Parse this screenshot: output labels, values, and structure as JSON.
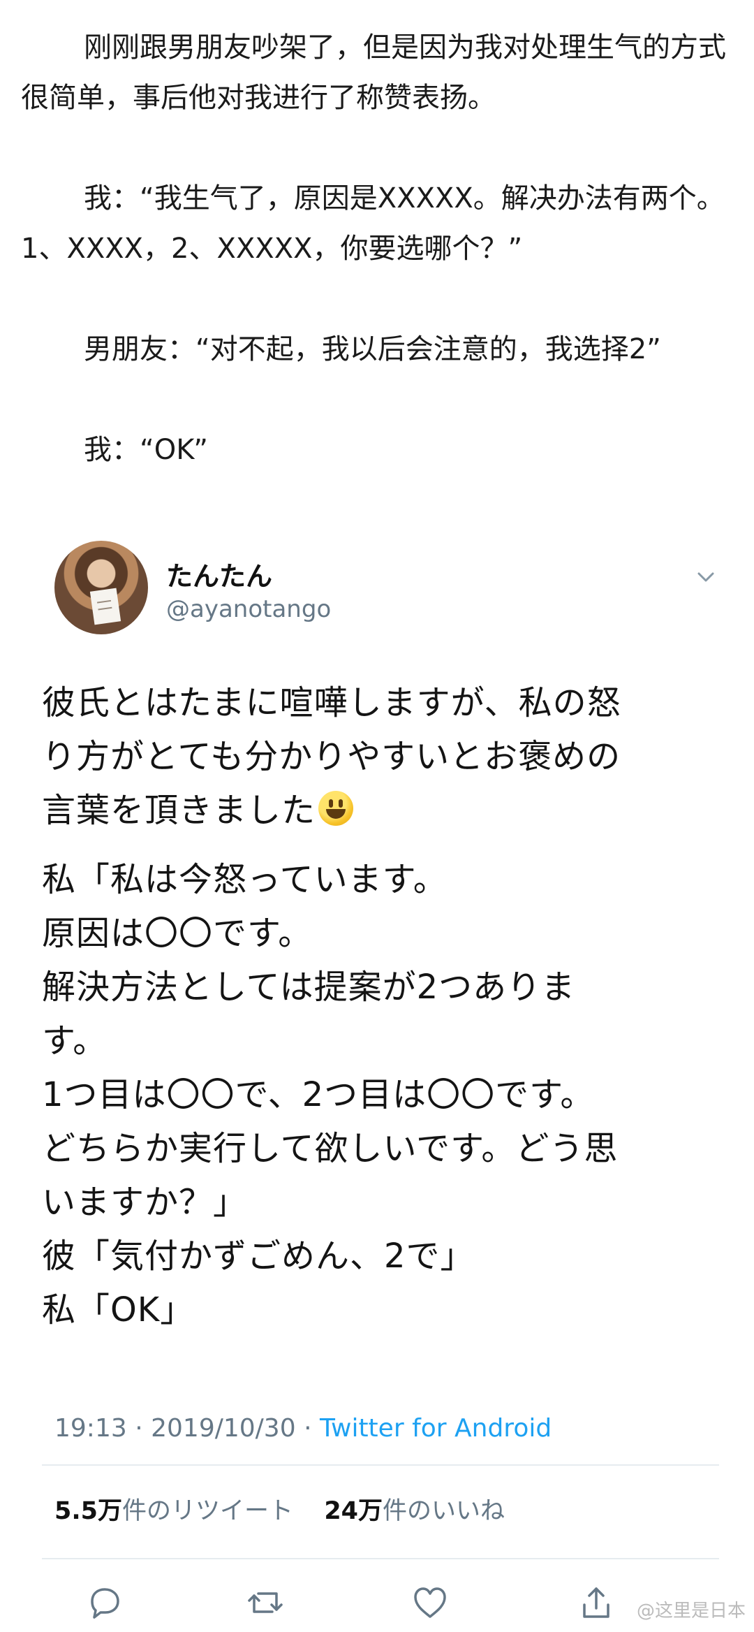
{
  "intro": {
    "paragraphs": [
      "刚刚跟男朋友吵架了，但是因为我对处理生气的方式很简单，事后他对我进行了称赞表扬。",
      "我：“我生气了，原因是XXXXX。解决办法有两个。1、XXXX，2、XXXXX，你要选哪个？”",
      "男朋友：“对不起，我以后会注意的，我选择2”",
      "我：“OK”"
    ]
  },
  "tweet": {
    "name": "たんたん",
    "handle": "@ayanotango",
    "icons": {
      "menu": "chevron-down-icon",
      "avatar": "avatar",
      "emoji": "grinning-face-emoji",
      "reply": "reply-icon",
      "retweet": "retweet-icon",
      "like": "heart-icon",
      "share": "share-icon"
    },
    "body": [
      "彼氏とはたまに喧嘩しますが、私の怒",
      "り方がとても分かりやすいとお褒めの",
      "言葉を頂きました",
      "",
      "私「私は今怒っています。",
      "原因は〇〇です。",
      "解決方法としては提案が2つありま",
      "す。",
      "1つ目は〇〇で、2つ目は〇〇です。",
      "どちらか実行して欲しいです。どう思",
      "いますか？」",
      "彼「気付かずごめん、2で」",
      "私「OK」"
    ],
    "time": "19:13",
    "date": "2019/10/30",
    "separator": "·",
    "source": "Twitter for Android",
    "retweet_count": "5.5万",
    "retweet_label": "件のリツイート",
    "like_count": "24万",
    "like_label": "件のいいね"
  },
  "watermark": "@这里是日本",
  "colors": {
    "text": "#141414",
    "secondary": "#657786",
    "link": "#1da1f2",
    "divider": "#e6ecf0"
  }
}
